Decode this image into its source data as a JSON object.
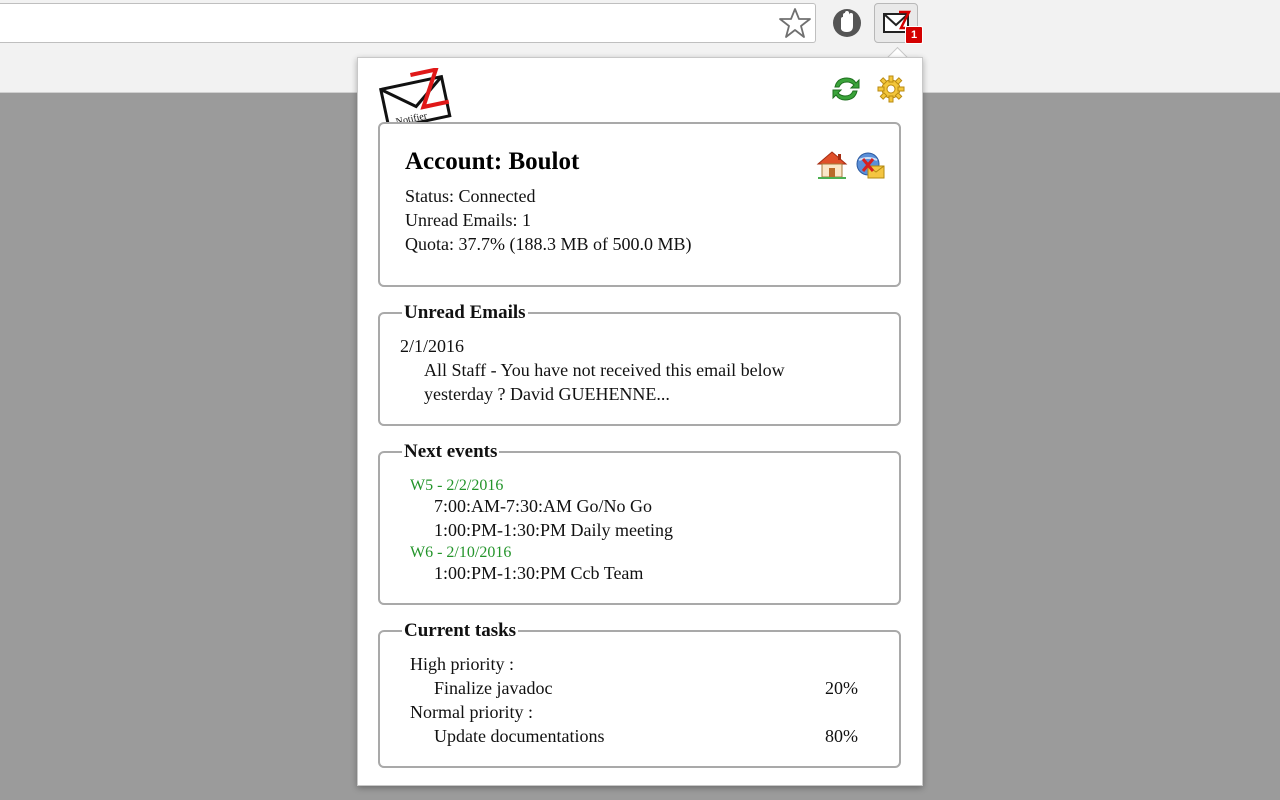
{
  "browser": {
    "bookmark_icon": "star-icon",
    "extension_icon": "hand-shield-icon",
    "mail_extension_icon": "mail-icon",
    "mail_badge": "1",
    "badge_color": "#d40000"
  },
  "popup": {
    "logo_text": "Notifier",
    "account": {
      "title": "Account: Boulot",
      "status": "Status: Connected",
      "unread": "Unread Emails: 1",
      "quota": "Quota: 37.7% (188.3 MB of 500.0 MB)"
    },
    "unread_emails": {
      "legend": "Unread Emails",
      "items": [
        {
          "date": "2/1/2016",
          "line1": "All Staff - You have not received this email below",
          "line2": "yesterday ? David GUEHENNE..."
        }
      ]
    },
    "next_events": {
      "legend": "Next events",
      "groups": [
        {
          "header": "W5 - 2/2/2016",
          "events": [
            "7:00:AM-7:30:AM Go/No Go",
            "1:00:PM-1:30:PM Daily meeting"
          ]
        },
        {
          "header": "W6 - 2/10/2016",
          "events": [
            "1:00:PM-1:30:PM Ccb Team"
          ]
        }
      ]
    },
    "current_tasks": {
      "legend": "Current tasks",
      "groups": [
        {
          "header": "High priority :",
          "tasks": [
            {
              "name": "Finalize javadoc",
              "percent": "20%"
            }
          ]
        },
        {
          "header": "Normal priority :",
          "tasks": [
            {
              "name": "Update documentations",
              "percent": "80%"
            }
          ]
        }
      ]
    },
    "colors": {
      "accent_green": "#23942a",
      "priority_red": "#e8141b"
    }
  }
}
